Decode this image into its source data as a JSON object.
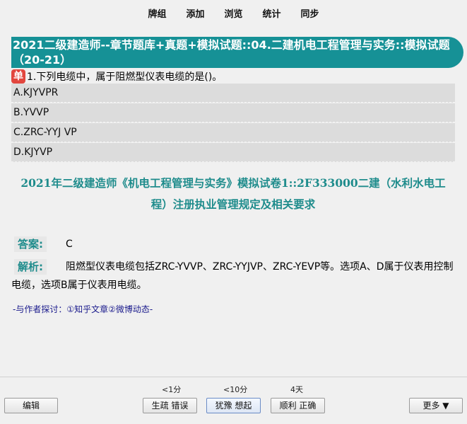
{
  "menu": {
    "items": [
      "牌组",
      "添加",
      "浏览",
      "统计",
      "同步"
    ]
  },
  "card": {
    "title": "2021二级建造师--章节题库+真题+模拟试题::04.二建机电工程管理与实务::模拟试题（20-21）",
    "badge": "单",
    "question": "1.下列电缆中，属于阻燃型仪表电缆的是()。",
    "options": [
      "A.KJYVPR",
      "B.YVVP",
      "C.ZRC-YYJ VP",
      "D.KJYVP"
    ],
    "source": "2021年二级建造师《机电工程管理与实务》模拟试卷1::2F333000二建（水利水电工程）注册执业管理规定及相关要求",
    "answer_label": "答案:",
    "answer_value": "C",
    "explain_label": "解析:",
    "explain_text": "阻燃型仪表电缆包括ZRC-YVVP、ZRC-YYJVP、ZRC-YEVP等。选项A、D属于仪表用控制电缆，选项B属于仪表用电缆。",
    "discuss": "-与作者探讨：①知乎文章②微博动态-"
  },
  "bottom": {
    "edit_label": "编辑",
    "hints": [
      "<1分",
      "<10分",
      "4天"
    ],
    "buttons": [
      "生疏 错误",
      "犹豫 想起",
      "顺利 正确"
    ],
    "more_label": "更多 ▼"
  }
}
